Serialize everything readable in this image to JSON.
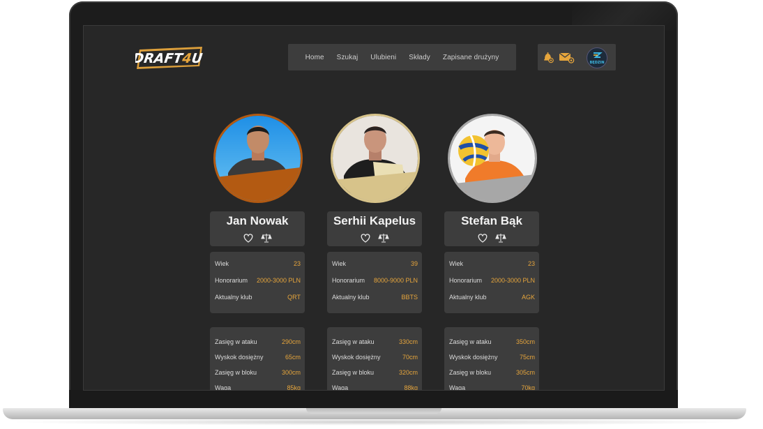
{
  "brand": {
    "logo_text": "DRAFT4U"
  },
  "nav": {
    "items": [
      "Home",
      "Szukaj",
      "Ulubieni",
      "Składy",
      "Zapisane drużyny"
    ]
  },
  "header_actions": {
    "icons": [
      "bell-coin-icon",
      "mail-coin-icon",
      "club-avatar"
    ],
    "club_avatar_text": "BĘDZIN"
  },
  "colors": {
    "accent": "#e6a53c",
    "bronze": "#b35a12",
    "gold": "#d7c38a",
    "silver": "#a7a7a7"
  },
  "players": [
    {
      "name": "Jan Nowak",
      "medal": "bronze",
      "info": [
        {
          "label": "Wiek",
          "value": "23"
        },
        {
          "label": "Honorarium",
          "value": "2000-3000 PLN"
        },
        {
          "label": "Aktualny klub",
          "value": "QRT"
        }
      ],
      "stats": [
        {
          "label": "Zasięg w ataku",
          "value": "290cm"
        },
        {
          "label": "Wyskok dosiężny",
          "value": "65cm"
        },
        {
          "label": "Zasięg w bloku",
          "value": "300cm"
        },
        {
          "label": "Waga",
          "value": "85kg"
        }
      ]
    },
    {
      "name": "Serhii Kapelus",
      "medal": "gold",
      "info": [
        {
          "label": "Wiek",
          "value": "39"
        },
        {
          "label": "Honorarium",
          "value": "8000-9000 PLN"
        },
        {
          "label": "Aktualny klub",
          "value": "BBTS"
        }
      ],
      "stats": [
        {
          "label": "Zasięg w ataku",
          "value": "330cm"
        },
        {
          "label": "Wyskok dosiężny",
          "value": "70cm"
        },
        {
          "label": "Zasięg w bloku",
          "value": "320cm"
        },
        {
          "label": "Waga",
          "value": "88kg"
        }
      ]
    },
    {
      "name": "Stefan Bąk",
      "medal": "silver",
      "info": [
        {
          "label": "Wiek",
          "value": "23"
        },
        {
          "label": "Honorarium",
          "value": "2000-3000 PLN"
        },
        {
          "label": "Aktualny klub",
          "value": "AGK"
        }
      ],
      "stats": [
        {
          "label": "Zasięg w ataku",
          "value": "350cm"
        },
        {
          "label": "Wyskok dosiężny",
          "value": "75cm"
        },
        {
          "label": "Zasięg w bloku",
          "value": "305cm"
        },
        {
          "label": "Waga",
          "value": "70kg"
        }
      ]
    }
  ]
}
